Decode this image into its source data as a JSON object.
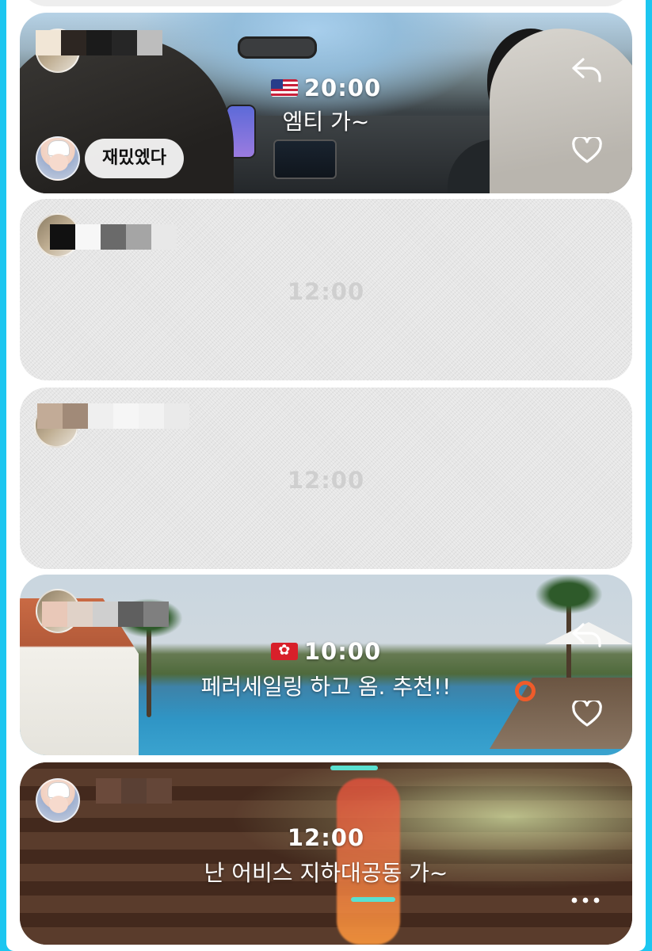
{
  "feed": {
    "posts": [
      {
        "flag": "US",
        "time": "20:00",
        "caption": "엠티 가~",
        "comment": "재밌엤다",
        "icons": [
          "reply-icon",
          "heart-icon"
        ]
      },
      {
        "time": "12:00",
        "state": "blurred"
      },
      {
        "time": "12:00",
        "state": "blurred"
      },
      {
        "flag": "HK",
        "time": "10:00",
        "caption": "페러세일링 하고 옴. 추천!!",
        "icons": [
          "reply-icon",
          "heart-icon"
        ]
      },
      {
        "time": "12:00",
        "caption": "난 어비스 지하대공동 가~",
        "icons": [
          "more-icon"
        ]
      }
    ]
  },
  "colors": {
    "frame": "#1cc6f0",
    "card_blank": "#e6e6e6",
    "overlay_text": "#ffffff"
  }
}
